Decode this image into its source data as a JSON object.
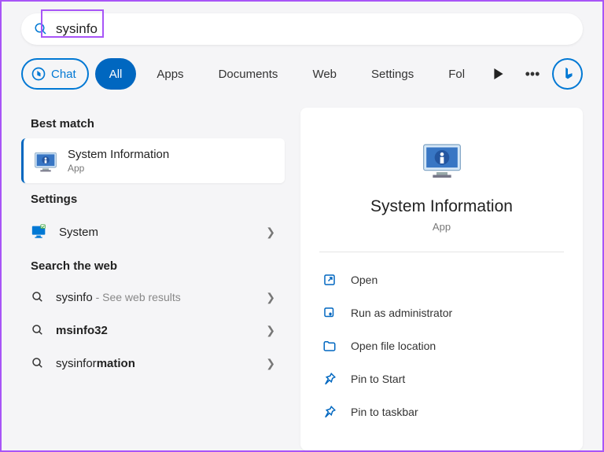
{
  "search": {
    "query": "sysinfo"
  },
  "tabs": {
    "chat": "Chat",
    "all": "All",
    "apps": "Apps",
    "documents": "Documents",
    "web": "Web",
    "settings": "Settings",
    "folders": "Fol"
  },
  "sections": {
    "best_match": "Best match",
    "settings": "Settings",
    "search_web": "Search the web"
  },
  "best_match": {
    "title": "System Information",
    "subtitle": "App"
  },
  "settings_results": [
    {
      "label": "System"
    }
  ],
  "web_results": [
    {
      "term": "sysinfo",
      "suffix": " - See web results"
    },
    {
      "term": "msinfo32",
      "suffix": ""
    },
    {
      "prefix": "sysinfor",
      "bold": "mation",
      "suffix": ""
    }
  ],
  "detail": {
    "title": "System Information",
    "type": "App",
    "actions": {
      "open": "Open",
      "admin": "Run as administrator",
      "location": "Open file location",
      "pin_start": "Pin to Start",
      "pin_taskbar": "Pin to taskbar"
    }
  }
}
